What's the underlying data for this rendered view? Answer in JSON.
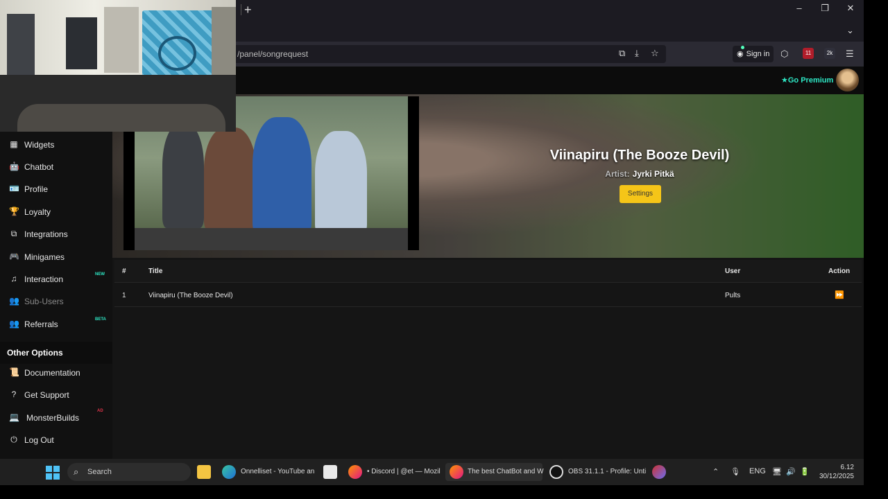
{
  "browser": {
    "new_tab": "+",
    "url": "/panel/songrequest",
    "sign_in": "Sign in",
    "ext_badge_1": "11",
    "ext_badge_2": "2k",
    "win_min": "–",
    "win_max": "❐",
    "win_close": "✕",
    "tab_list": "⌄"
  },
  "site": {
    "premium": "Go Premium"
  },
  "sidebar": {
    "items": [
      {
        "label": "Widgets",
        "icon": "widgets-icon",
        "glyph": "▦"
      },
      {
        "label": "Chatbot",
        "icon": "robot-icon",
        "glyph": "🤖"
      },
      {
        "label": "Profile",
        "icon": "id-card-icon",
        "glyph": "🪪"
      },
      {
        "label": "Loyalty",
        "icon": "trophy-icon",
        "glyph": "🏆"
      },
      {
        "label": "Integrations",
        "icon": "plug-icon",
        "glyph": "⧉"
      },
      {
        "label": "Minigames",
        "icon": "gamepad-icon",
        "glyph": "🎮"
      },
      {
        "label": "Interaction",
        "icon": "music-icon",
        "glyph": "♫",
        "badge": "NEW"
      },
      {
        "label": "Sub-Users",
        "icon": "users-icon",
        "glyph": "👥"
      },
      {
        "label": "Referrals",
        "icon": "user-group-icon",
        "glyph": "👥",
        "badge": "BETA"
      }
    ],
    "other_header": "Other Options",
    "other_items": [
      {
        "label": "Documentation",
        "icon": "scroll-icon",
        "glyph": "📜"
      },
      {
        "label": "Get Support",
        "icon": "question-icon",
        "glyph": "?"
      },
      {
        "label": "MonsterBuilds",
        "icon": "laptop-icon",
        "glyph": "💻",
        "badge": "AD"
      },
      {
        "label": "Log Out",
        "icon": "logout-icon",
        "glyph": "⏻"
      }
    ]
  },
  "now_playing": {
    "title": "Viinapiru (The Booze Devil)",
    "artist_label": "Artist:",
    "artist": "Jyrki Pitkä",
    "settings_button": "Settings"
  },
  "table": {
    "columns": {
      "num": "#",
      "title": "Title",
      "user": "User",
      "action": "Action"
    },
    "rows": [
      {
        "num": "1",
        "title": "Viinapiru (The Booze Devil)",
        "user": "Pults",
        "action": "skip"
      }
    ]
  },
  "taskbar": {
    "search": "Search",
    "apps": [
      {
        "label": "Onnelliset - YouTube an",
        "icon": "edge-icon"
      },
      {
        "label": "• Discord | @et — Mozil",
        "icon": "firefox-icon"
      },
      {
        "label": "The best ChatBot and W",
        "icon": "firefox-icon"
      },
      {
        "label": "OBS 31.1.1 - Profile: Unti",
        "icon": "obs-icon"
      }
    ],
    "lang": "ENG",
    "time": "6.12",
    "date": "30/12/2025"
  },
  "colors": {
    "accent_premium": "#2ee9c6",
    "settings_button": "#f5c518",
    "badge_new": "#2ee9c6",
    "badge_beta": "#2ee9c6",
    "badge_ad": "#e0344a"
  }
}
